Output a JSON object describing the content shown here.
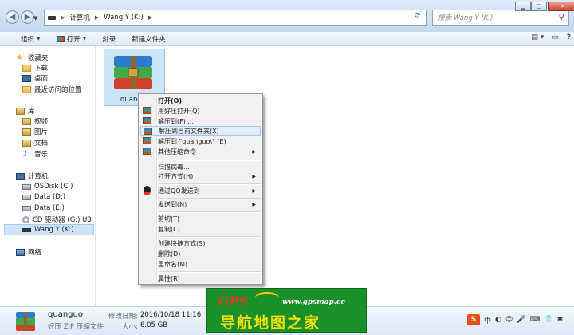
{
  "address": {
    "crumbs": [
      "计算机",
      "Wang Y (K:)"
    ],
    "search_placeholder": "搜索 Wang Y (K:)"
  },
  "toolbar": {
    "organize": "组织",
    "open": "打开",
    "burn": "刻录",
    "new_folder": "新建文件夹"
  },
  "nav": {
    "favorites": "收藏夹",
    "downloads": "下载",
    "desktop": "桌面",
    "recent": "最近访问的位置",
    "libraries": "库",
    "videos": "视频",
    "pictures": "图片",
    "documents": "文档",
    "music": "音乐",
    "computer": "计算机",
    "osdisk": "OSDisk (C:)",
    "data_d": "Data (D:)",
    "data_e": "Data (E:)",
    "cd": "CD 驱动器 (G:) U3",
    "wangy": "Wang Y (K:)",
    "network": "网络"
  },
  "file": {
    "label": "quanguo"
  },
  "menu": {
    "open": "打开(O)",
    "open_haozip": "用好压打开(Q)",
    "extract_to": "解压到(F) ...",
    "extract_here": "解压到当前文件夹(X)",
    "extract_named": "解压到 \"quanguo\\\" (E)",
    "other_cmds": "其他压缩命令",
    "scan": "扫描病毒...",
    "open_with": "打开方式(H)",
    "qq_send": "通过QQ发送到",
    "send_to": "发送到(N)",
    "cut": "剪切(T)",
    "copy": "复制(C)",
    "shortcut": "创建快捷方式(S)",
    "delete": "删除(D)",
    "rename": "重命名(M)",
    "properties": "属性(R)"
  },
  "status": {
    "name": "quanguo",
    "type": "好压 ZIP 压缩文件",
    "modified_label": "修改日期:",
    "modified_value": "2016/10/18 11:16",
    "size_label": "大小:",
    "size_value": "6.05 GB"
  },
  "watermark": {
    "brand": "GPS",
    "url": "www.gpsmap.cc",
    "slogan": "导航地图之家"
  },
  "ime": {
    "logo": "S",
    "mode": "中"
  }
}
